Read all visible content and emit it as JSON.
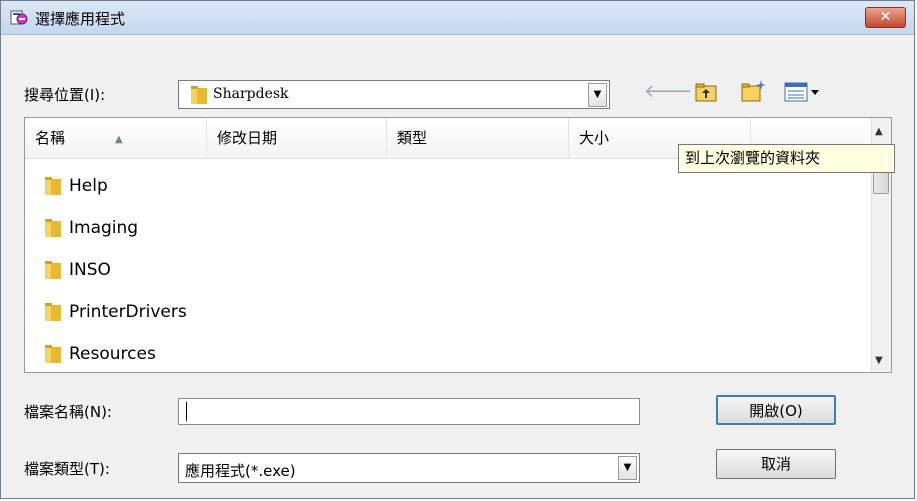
{
  "window": {
    "title": "選擇應用程式",
    "close_glyph": "✕"
  },
  "toolbar": {
    "lookin_label": "搜尋位置(I):",
    "lookin_value": "Sharpdesk",
    "icons": [
      "back-arrow-icon",
      "up-folder-icon",
      "new-folder-icon",
      "view-menu-icon"
    ]
  },
  "columns": [
    "名稱",
    "修改日期",
    "類型",
    "大小"
  ],
  "files": [
    {
      "name": "Help"
    },
    {
      "name": "Imaging"
    },
    {
      "name": "INSO"
    },
    {
      "name": "PrinterDrivers"
    },
    {
      "name": "Resources"
    }
  ],
  "tooltip": "到上次瀏覽的資料夾",
  "filename": {
    "label": "檔案名稱(N):",
    "value": ""
  },
  "filetype": {
    "label": "檔案類型(T):",
    "value": "應用程式(*.exe)"
  },
  "buttons": {
    "open": "開啟(O)",
    "cancel": "取消"
  },
  "colors": {
    "folder": "#e8b830",
    "title_bg": "#c9daf0",
    "close_red": "#c44a2c"
  }
}
